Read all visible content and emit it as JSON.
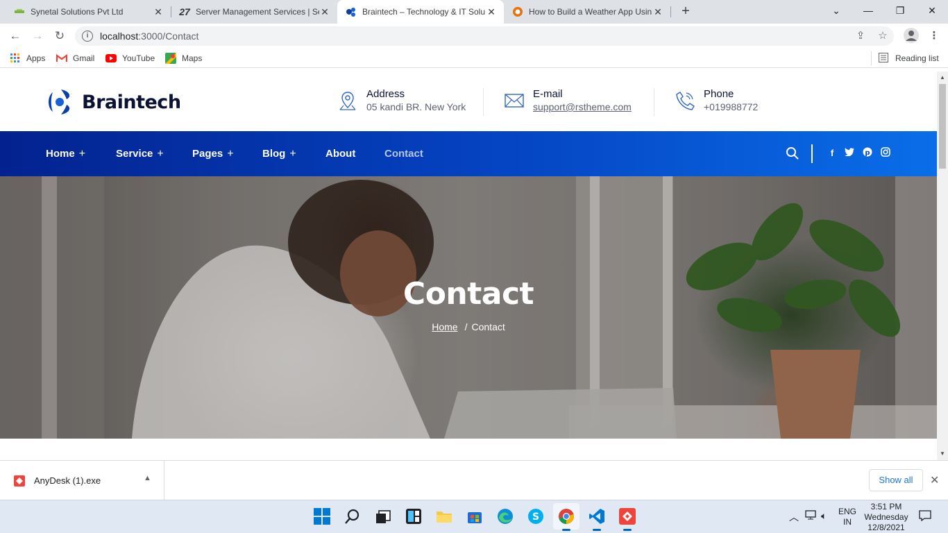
{
  "browser": {
    "tabs": [
      {
        "title": "Synetal Solutions Pvt Ltd",
        "active": false
      },
      {
        "title": "Server Management Services | Se",
        "active": false
      },
      {
        "title": "Braintech – Technology & IT Solu",
        "active": true
      },
      {
        "title": "How to Build a Weather App Usin",
        "active": false
      }
    ],
    "url_host": "localhost",
    "url_rest": ":3000/Contact",
    "bookmarks": [
      {
        "label": "Apps",
        "icon": "apps-grid-icon"
      },
      {
        "label": "Gmail",
        "icon": "gmail-icon"
      },
      {
        "label": "YouTube",
        "icon": "youtube-icon"
      },
      {
        "label": "Maps",
        "icon": "maps-icon"
      }
    ],
    "reading_list": "Reading list"
  },
  "site": {
    "logo_text": "Braintech",
    "contacts": [
      {
        "title": "Address",
        "value": "05 kandi BR. New York",
        "icon": "map-pin-icon"
      },
      {
        "title": "E-mail",
        "value": "support@rstheme.com",
        "icon": "envelope-icon"
      },
      {
        "title": "Phone",
        "value": "+019988772",
        "icon": "phone-icon"
      }
    ],
    "nav": [
      {
        "label": "Home",
        "has_sub": true
      },
      {
        "label": "Service",
        "has_sub": true
      },
      {
        "label": "Pages",
        "has_sub": true
      },
      {
        "label": "Blog",
        "has_sub": true
      },
      {
        "label": "About",
        "has_sub": false
      },
      {
        "label": "Contact",
        "has_sub": false,
        "active": true
      }
    ],
    "nav_plus": "+",
    "social": [
      "facebook-icon",
      "twitter-icon",
      "pinterest-icon",
      "instagram-icon"
    ],
    "colors": {
      "nav_start": "#03228f",
      "nav_end": "#0a6ee8",
      "text_dark": "#0b1233"
    }
  },
  "hero": {
    "title": "Contact",
    "breadcrumb_home": "Home",
    "breadcrumb_sep": "/",
    "breadcrumb_current": "Contact"
  },
  "download_bar": {
    "file": "AnyDesk (1).exe",
    "show_all": "Show all"
  },
  "taskbar": {
    "lang_top": "ENG",
    "lang_bottom": "IN",
    "time": "3:51 PM",
    "day": "Wednesday",
    "date": "12/8/2021"
  }
}
